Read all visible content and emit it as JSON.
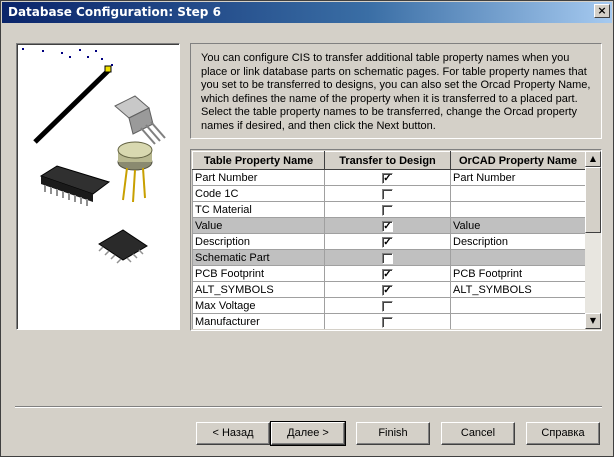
{
  "window": {
    "title": "Database Configuration: Step 6",
    "close_glyph": "×"
  },
  "description": "You can configure CIS to transfer additional table property names when you place or link database parts on schematic pages. For table property names that you set to be transferred to designs, you can also set the Orcad Property Name, which defines the name of the property when it is transferred to a placed part. Select the table property names to be transferred, change the Orcad property names if desired, and then click the Next button.",
  "grid": {
    "headers": [
      "Table Property Name",
      "Transfer to Design",
      "OrCAD Property Name"
    ],
    "rows": [
      {
        "name": "Part Number",
        "checked": true,
        "orcad": "Part Number",
        "shaded": false
      },
      {
        "name": "Code 1C",
        "checked": false,
        "orcad": "",
        "shaded": false
      },
      {
        "name": "TC Material",
        "checked": false,
        "orcad": "",
        "shaded": false
      },
      {
        "name": "Value",
        "checked": true,
        "orcad": "Value",
        "shaded": true
      },
      {
        "name": "Description",
        "checked": true,
        "orcad": "Description",
        "shaded": false
      },
      {
        "name": "Schematic Part",
        "checked": false,
        "orcad": "",
        "shaded": true
      },
      {
        "name": "PCB Footprint",
        "checked": true,
        "orcad": "PCB Footprint",
        "shaded": false
      },
      {
        "name": "ALT_SYMBOLS",
        "checked": true,
        "orcad": "ALT_SYMBOLS",
        "shaded": false
      },
      {
        "name": "Max Voltage",
        "checked": false,
        "orcad": "",
        "shaded": false
      },
      {
        "name": "Manufacturer",
        "checked": false,
        "orcad": "",
        "shaded": false
      }
    ],
    "check_glyph": "✓",
    "scroll_up_glyph": "▲",
    "scroll_down_glyph": "▼"
  },
  "buttons": {
    "back": "< Назад",
    "next": "Далее >",
    "finish": "Finish",
    "cancel": "Cancel",
    "help": "Справка"
  },
  "icons": {
    "close": "close-icon",
    "illustration": "electronic-components-illustration"
  },
  "colors": {
    "title_gradient_start": "#0a246a",
    "title_gradient_end": "#a6caf0",
    "dialog_bg": "#d4d0c8",
    "shaded_row": "#c0c0c0"
  }
}
